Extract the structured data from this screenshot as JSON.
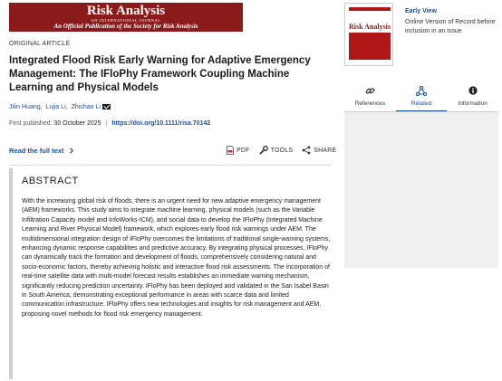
{
  "journal": {
    "title": "Risk Analysis",
    "subtitle_small": "AN INTERNATIONAL JOURNAL",
    "subtitle": "An Official Publication of the Society for Risk Analysis",
    "banner_color": "#8b1a1a"
  },
  "article": {
    "type": "ORIGINAL ARTICLE",
    "title": "Integrated Flood Risk Early Warning for Adaptive Emergency Management: The IFloPhy Framework Coupling Machine Learning and Physical Models",
    "authors": [
      "Jilin Huang,",
      "Lujia Li,",
      "Zhichao Li"
    ],
    "first_published_label": "First published:",
    "first_published_date": "30 October 2025",
    "doi": "https://doi.org/10.1111/risa.70142",
    "read_full_label": "Read the full text",
    "tools": {
      "pdf_label": "PDF",
      "tools_label": "TOOLS",
      "share_label": "SHARE"
    }
  },
  "abstract": {
    "heading": "ABSTRACT",
    "text": "With the increasing global risk of floods, there is an urgent need for new adaptive emergency management (AEM) frameworks. This study aims to integrate machine learning, physical models (such as the Variable Infiltration Capacity model and InfoWorks-ICM), and social data to develop the IFloPhy (Integrated Machine Learning and River Physical Model) framework, which explores early flood risk warnings under AEM. The multidimensional integration design of IFloPhy overcomes the limitations of traditional single-warning systems, enhancing dynamic response capabilities and predictive accuracy. By integrating physical processes, IFloPhy can dynamically track the formation and development of floods, comprehensively considering natural and socio-economic factors, thereby achieving holistic and interactive flood risk assessments. The incorporation of real-time satellite data with multi-model forecast results establishes an immediate warning mechanism, significantly reducing prediction uncertainty. IFloPhy has been deployed and validated in the San Isabel Basin in South America, demonstrating exceptional performance in areas with scarce data and limited communication infrastructure. IFloPhy offers new technologies and insights for risk management and AEM, proposing novel methods for flood risk emergency management."
  },
  "sidebar": {
    "cover_title": "Risk Analysis",
    "early_view": "Early View",
    "record_text": "Online Version of Record before inclusion in an issue",
    "tabs": [
      {
        "label": "References",
        "icon": "link-icon"
      },
      {
        "label": "Related",
        "icon": "network-icon",
        "active": true
      },
      {
        "label": "Information",
        "icon": "info-icon"
      }
    ],
    "accent_color": "#1a4fa0"
  }
}
